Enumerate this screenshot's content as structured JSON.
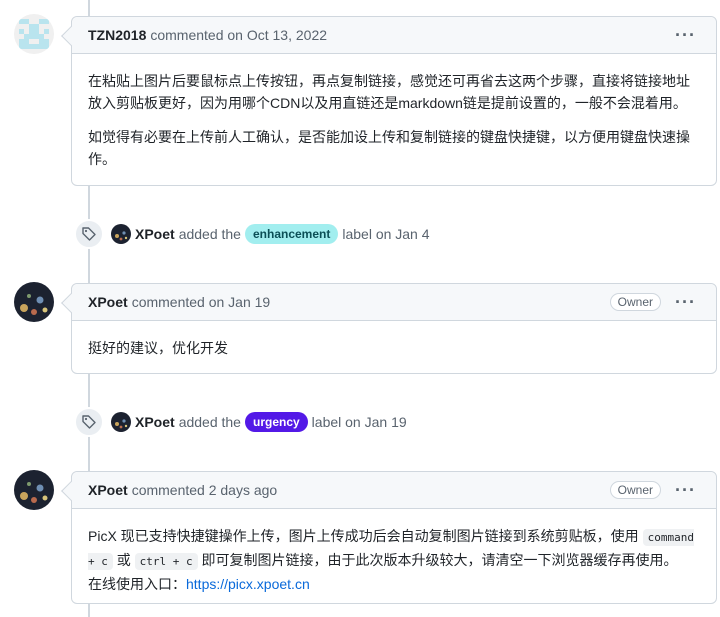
{
  "comments": [
    {
      "author": "TZN2018",
      "meta": "commented on Oct 13, 2022",
      "badge": "",
      "paragraphs": [
        "在粘贴上图片后要鼠标点上传按钮，再点复制链接，感觉还可再省去这两个步骤，直接将链接地址放入剪贴板更好，因为用哪个CDN以及用直链还是markdown链是提前设置的，一般不会混着用。",
        "如觉得有必要在上传前人工确认，是否能加设上传和复制链接的键盘快捷键，以方便用键盘快速操作。"
      ]
    },
    {
      "author": "XPoet",
      "meta": "commented on Jan 19",
      "badge": "Owner",
      "text": "挺好的建议，优化开发"
    },
    {
      "author": "XPoet",
      "meta": "commented 2 days ago",
      "badge": "Owner",
      "text_1": "PicX 现已支持快捷键操作上传，图片上传成功后会自动复制图片链接到系统剪贴板，使用",
      "code_1": "command + c",
      "text_2": "或",
      "code_2": "ctrl + c",
      "text_3": "即可复制图片链接，由于此次版本升级较大，请清空一下浏览器缓存再使用。",
      "text_4": "在线使用入口：",
      "link": "https://picx.xpoet.cn"
    }
  ],
  "events": [
    {
      "actor": "XPoet",
      "action": "added the",
      "label": "enhancement",
      "suffix": "label on Jan 4",
      "label_color": "#a2eeef"
    },
    {
      "actor": "XPoet",
      "action": "added the",
      "label": "urgency",
      "suffix": "label on Jan 19",
      "label_color": "#5319e7"
    }
  ],
  "icons": {
    "more": "kebab-horizontal-icon",
    "tag": "tag-icon"
  }
}
